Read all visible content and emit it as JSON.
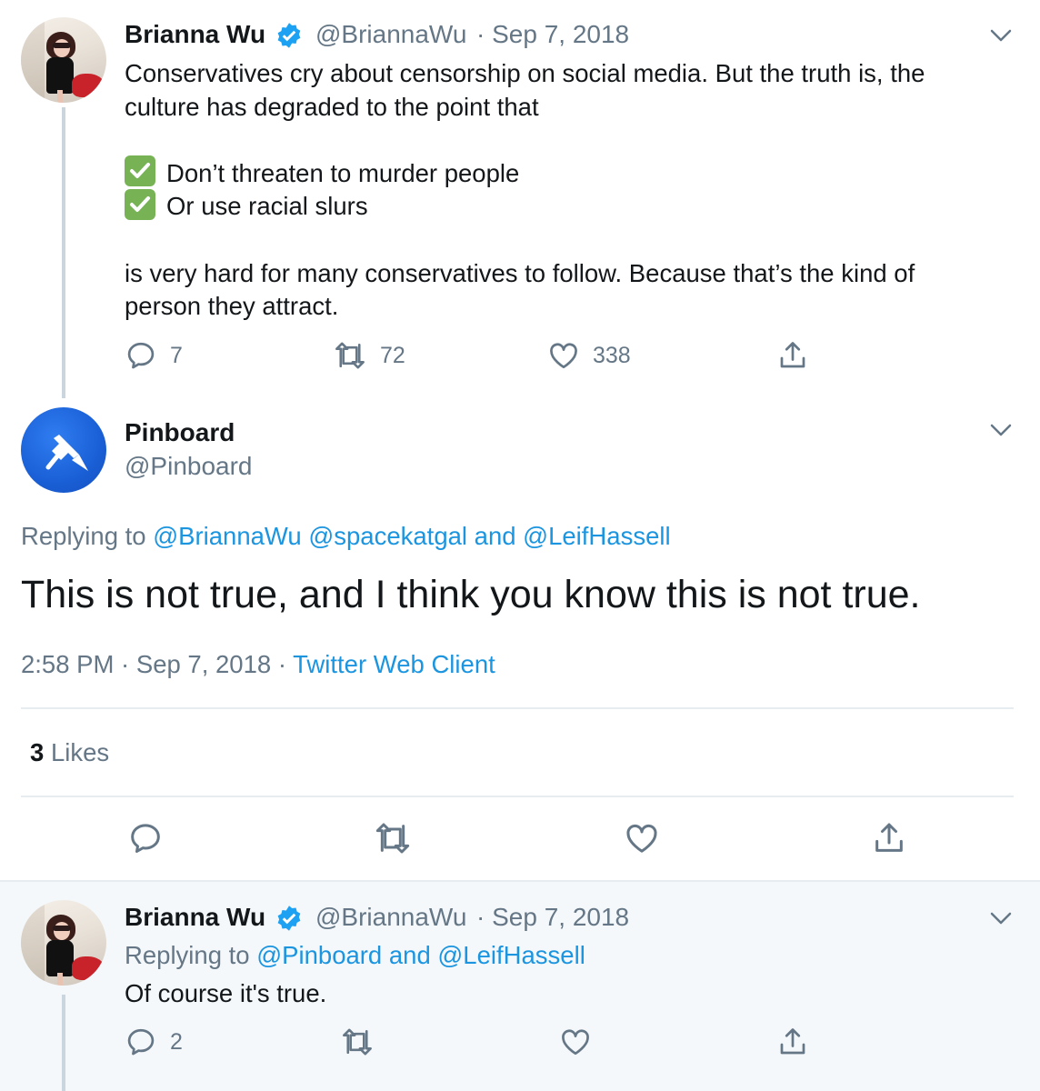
{
  "tweet1": {
    "name": "Brianna Wu",
    "handle": "@BriannaWu",
    "date": "· Sep 7, 2018",
    "text_line1": "Conservatives cry about censorship on social media. But the truth is, the",
    "text_line2": "culture has degraded to the point that",
    "check1": "Don’t threaten to murder people",
    "check2": "Or use racial slurs",
    "text_line3": "is very hard for many conservatives to follow. Because that’s the kind of",
    "text_line4": "person they attract.",
    "replies": "7",
    "retweets": "72",
    "likes": "338"
  },
  "main_tweet": {
    "name": "Pinboard",
    "handle": "@Pinboard",
    "replying_prefix": "Replying to",
    "replying_to": "@BriannaWu @spacekatgal and @LeifHassell",
    "text": "This is not true, and I think you know this is not true.",
    "time": "2:58 PM · Sep 7, 2018 ·",
    "client": "Twitter Web Client",
    "likes_count": "3",
    "likes_label": "Likes"
  },
  "tweet3": {
    "name": "Brianna Wu",
    "handle": "@BriannaWu",
    "date": "· Sep 7, 2018",
    "replying_prefix": "Replying to",
    "replying_to": "@Pinboard and @LeifHassell",
    "text": "Of course it's true.",
    "replies": "2"
  },
  "colors": {
    "link": "#1b95e0",
    "muted": "#657786",
    "reply_bg": "#f5f8fa",
    "verified": "#1da1f2",
    "pinboard_blue": "#1a5fd6",
    "check_green": "#77b255"
  }
}
